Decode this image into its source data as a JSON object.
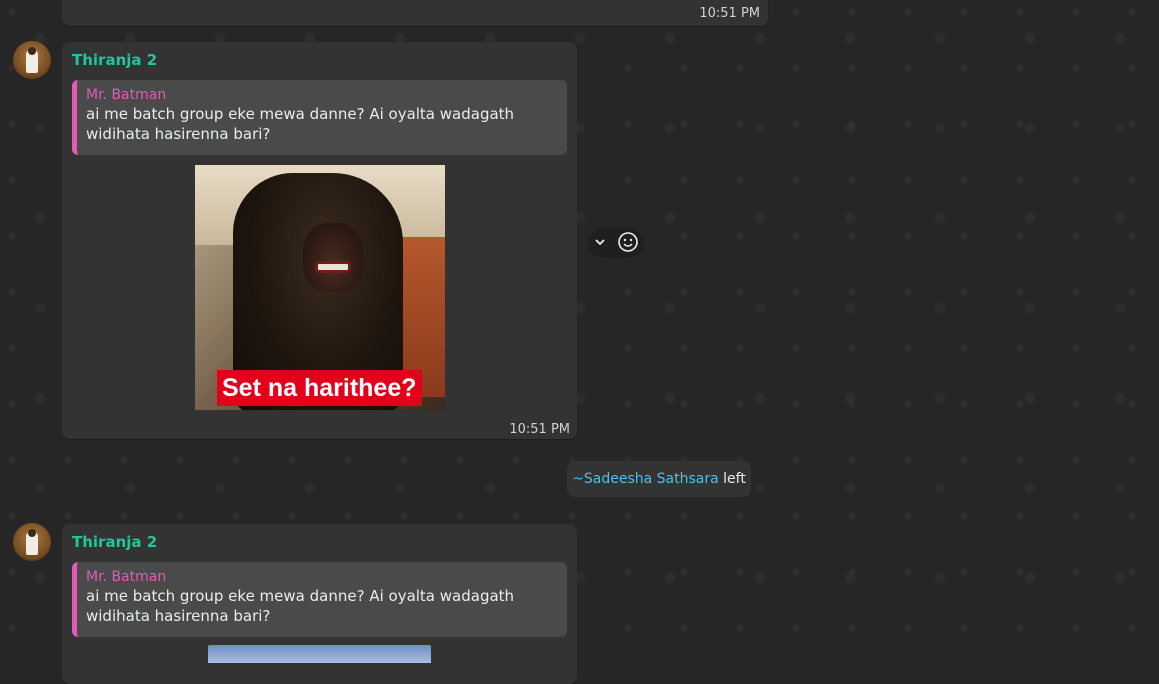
{
  "top_message": {
    "time": "10:51 PM"
  },
  "messages": [
    {
      "sender": "Thiranja 2",
      "quote": {
        "name": "Mr. Batman",
        "text": "ai me batch group eke mewa danne? Ai oyalta wadagath widihata hasirenna bari?"
      },
      "sticker_caption": "Set na harithee?",
      "time": "10:51 PM"
    },
    {
      "sender": "Thiranja 2",
      "quote": {
        "name": "Mr. Batman",
        "text": "ai me batch group eke mewa danne? Ai oyalta wadagath widihata hasirenna bari?"
      }
    }
  ],
  "system_message": {
    "name": "~Sadeesha Sathsara",
    "action": "left"
  },
  "reaction_bar": {
    "icons": [
      "chevron-down-icon",
      "emoji-icon"
    ]
  },
  "colors": {
    "sender_name": "#25c49a",
    "quote_accent": "#e05cb6",
    "mention": "#53bdeb",
    "bubble": "#333333",
    "background": "#262626"
  }
}
